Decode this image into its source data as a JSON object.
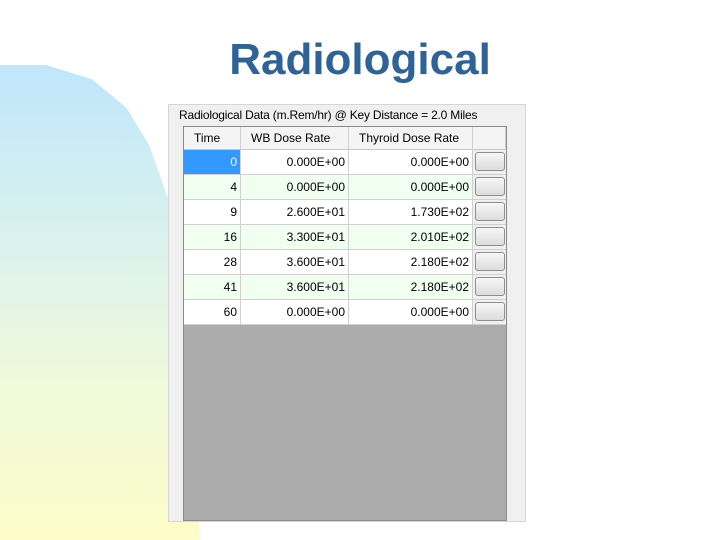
{
  "slide": {
    "title": "Radiological"
  },
  "panel": {
    "label": "Radiological Data (m.Rem/hr) @ Key Distance = 2.0 Miles",
    "columns": [
      "Time",
      "WB Dose Rate",
      "Thyroid Dose Rate"
    ],
    "rows": [
      {
        "time": "0",
        "wb": "0.000E+00",
        "thyroid": "0.000E+00"
      },
      {
        "time": "4",
        "wb": "0.000E+00",
        "thyroid": "0.000E+00"
      },
      {
        "time": "9",
        "wb": "2.600E+01",
        "thyroid": "1.730E+02"
      },
      {
        "time": "16",
        "wb": "3.300E+01",
        "thyroid": "2.010E+02"
      },
      {
        "time": "28",
        "wb": "3.600E+01",
        "thyroid": "2.180E+02"
      },
      {
        "time": "41",
        "wb": "3.600E+01",
        "thyroid": "2.180E+02"
      },
      {
        "time": "60",
        "wb": "0.000E+00",
        "thyroid": "0.000E+00"
      }
    ],
    "selected_row": 0
  },
  "colors": {
    "title": "#2f6398",
    "selection": "#3399ff",
    "row_alt": "#f0fff0",
    "grid_empty": "#ababab"
  }
}
